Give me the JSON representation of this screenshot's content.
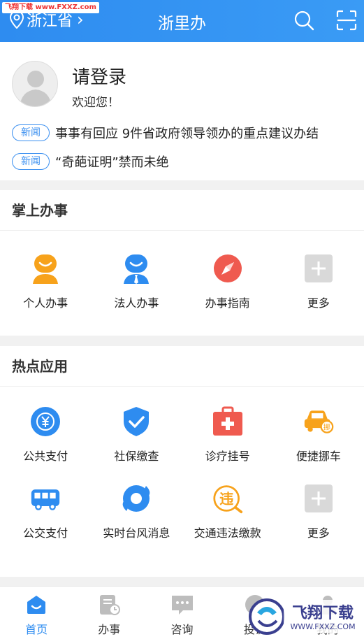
{
  "watermark": "飞翔下载 www.FXXZ.com",
  "header": {
    "location": "浙江省",
    "title": "浙里办"
  },
  "profile": {
    "login": "请登录",
    "welcome": "欢迎您！"
  },
  "news": [
    {
      "tag": "新闻",
      "text": "事事有回应 9件省政府领导领办的重点建议办结"
    },
    {
      "tag": "新闻",
      "text": "“奇葩证明”禁而未绝"
    }
  ],
  "section1": {
    "title": "掌上办事",
    "items": [
      {
        "label": "个人办事",
        "icon": "person-icon"
      },
      {
        "label": "法人办事",
        "icon": "corporate-icon"
      },
      {
        "label": "办事指南",
        "icon": "compass-icon"
      },
      {
        "label": "更多",
        "icon": "plus-icon"
      }
    ]
  },
  "section2": {
    "title": "热点应用",
    "items": [
      {
        "label": "公共支付",
        "icon": "yen-icon"
      },
      {
        "label": "社保缴查",
        "icon": "shield-check-icon"
      },
      {
        "label": "诊疗挂号",
        "icon": "medical-kit-icon"
      },
      {
        "label": "便捷挪车",
        "icon": "car-icon"
      },
      {
        "label": "公交支付",
        "icon": "bus-icon"
      },
      {
        "label": "实时台风消息",
        "icon": "typhoon-icon"
      },
      {
        "label": "交通违法缴款",
        "icon": "traffic-fine-icon"
      },
      {
        "label": "更多",
        "icon": "plus-icon"
      }
    ]
  },
  "tabs": [
    {
      "label": "首页",
      "active": true
    },
    {
      "label": "办事",
      "active": false
    },
    {
      "label": "咨询",
      "active": false
    },
    {
      "label": "投诉",
      "active": false
    },
    {
      "label": "我的",
      "active": false
    }
  ],
  "overlay_brand": "飞翔下载",
  "overlay_url": "WWW.FXXZ.COM",
  "colors": {
    "primary": "#2e8cf0",
    "orange": "#f7a21b",
    "red": "#ef5a4f",
    "gray": "#d5d5d5"
  }
}
